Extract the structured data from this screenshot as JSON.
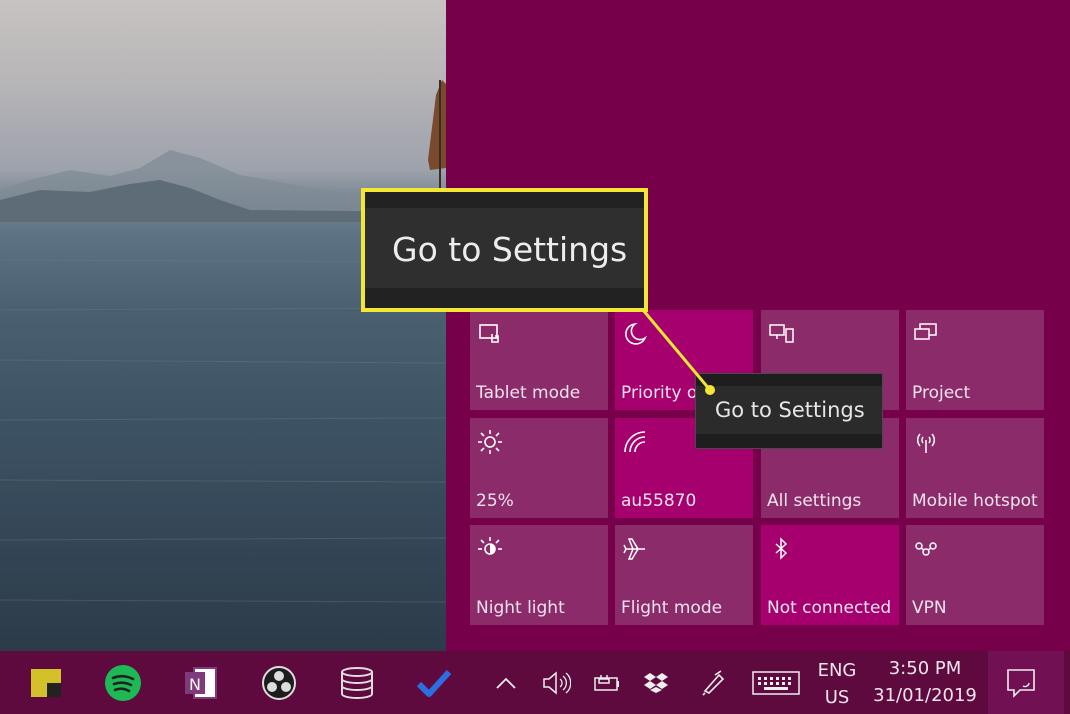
{
  "callout": {
    "text": "Go to Settings",
    "border_color": "#f3e734"
  },
  "tooltip": {
    "text": "Go to Settings"
  },
  "action_center": {
    "background": "#77004b",
    "tiles": [
      {
        "label": "Tablet mode",
        "icon": "tablet-mode-icon",
        "active": false
      },
      {
        "label": "Priority o",
        "icon": "moon-icon",
        "active": true
      },
      {
        "label": "",
        "icon": "connect-icon",
        "active": false
      },
      {
        "label": "Project",
        "icon": "project-icon",
        "active": false
      },
      {
        "label": "25%",
        "icon": "brightness-icon",
        "active": false
      },
      {
        "label": "au55870",
        "icon": "wifi-icon",
        "active": true
      },
      {
        "label": "All settings",
        "icon": "settings-icon",
        "active": false
      },
      {
        "label": "Mobile hotspot",
        "icon": "hotspot-icon",
        "active": false
      },
      {
        "label": "Night light",
        "icon": "night-light-icon",
        "active": false
      },
      {
        "label": "Flight mode",
        "icon": "airplane-icon",
        "active": false
      },
      {
        "label": "Not connected",
        "icon": "bluetooth-icon",
        "active": true
      },
      {
        "label": "VPN",
        "icon": "vpn-icon",
        "active": false
      }
    ]
  },
  "taskbar": {
    "apps": [
      "sticky-notes-icon",
      "spotify-icon",
      "onenote-icon",
      "obs-icon",
      "database-icon",
      "todo-check-icon"
    ],
    "language_line1": "ENG",
    "language_line2": "US",
    "time": "3:50 PM",
    "date": "31/01/2019"
  }
}
